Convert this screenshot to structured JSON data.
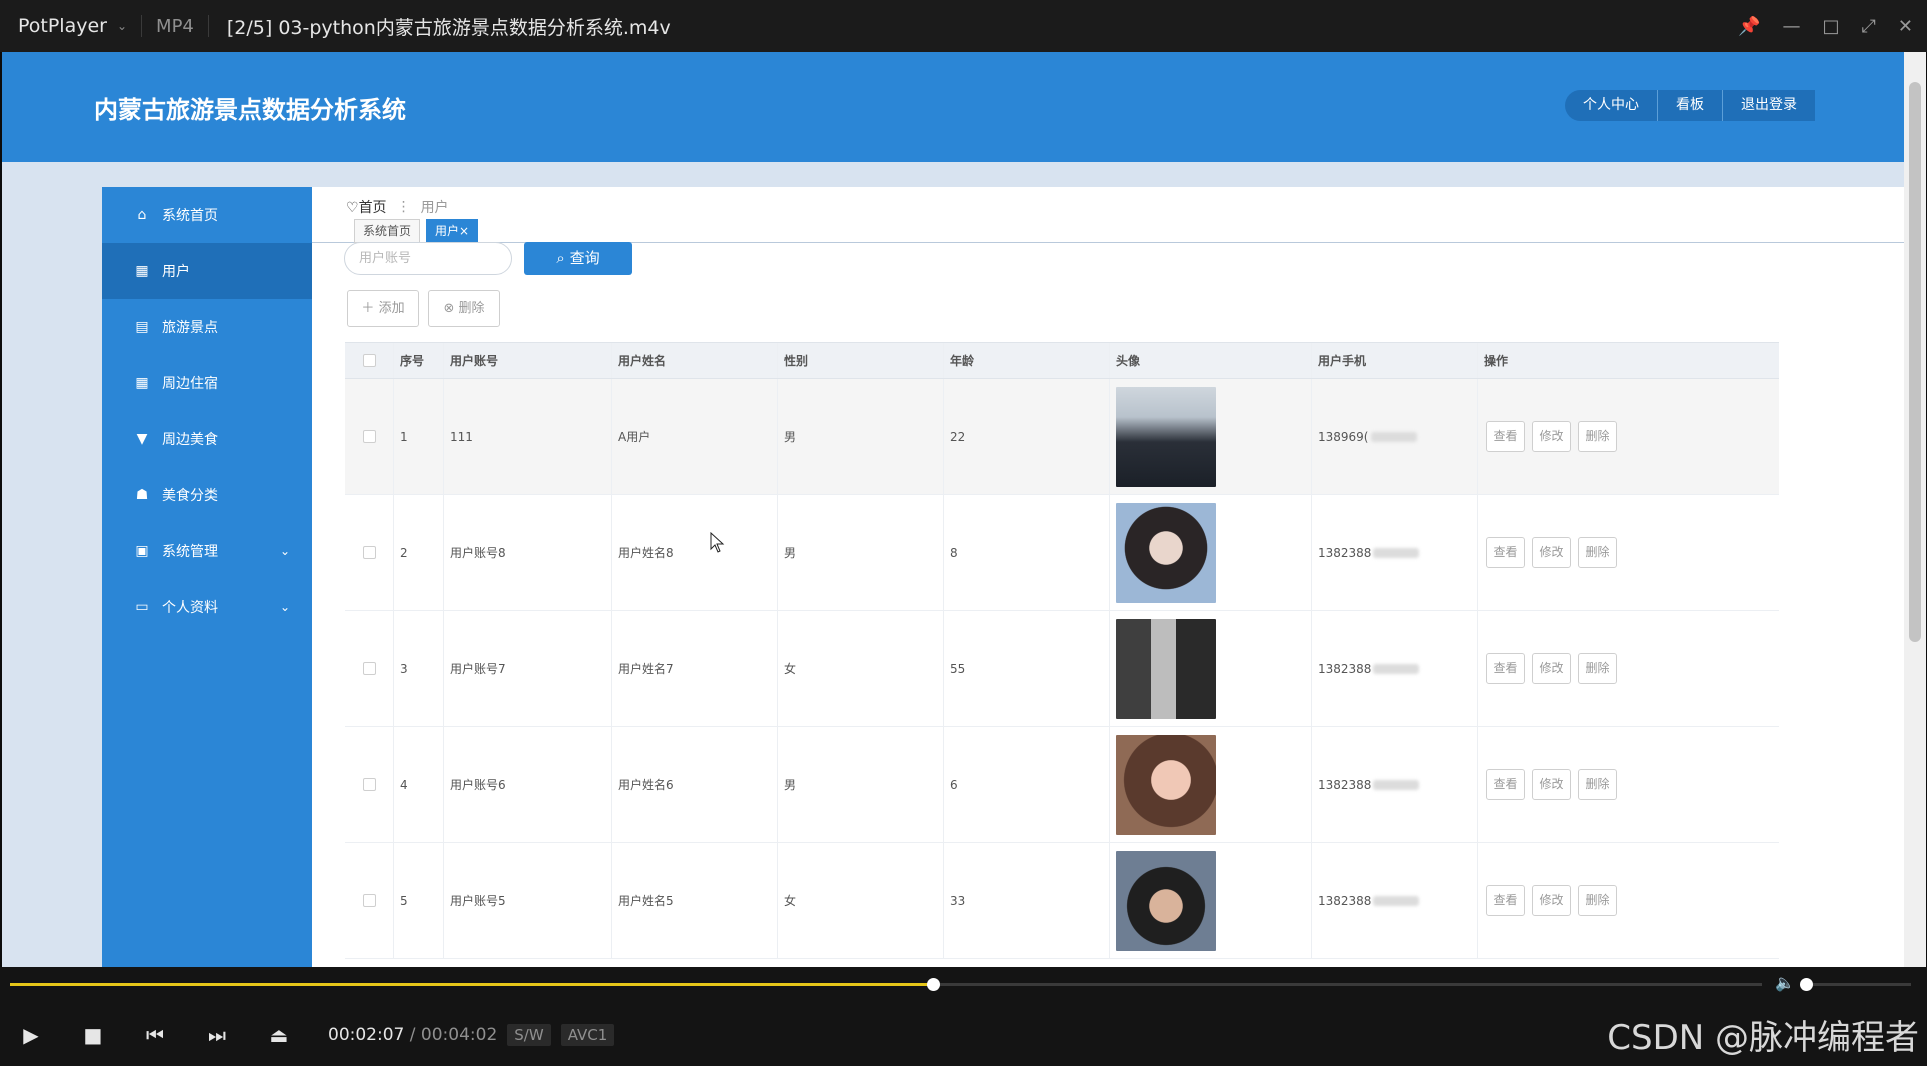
{
  "player": {
    "brand": "PotPlayer",
    "format": "MP4",
    "file_title": "[2/5] 03-python内蒙古旅游景点数据分析系统.m4v",
    "time_current": "00:02:07",
    "time_separator": "/",
    "time_total": "00:04:02",
    "badge_sw": "S/W",
    "badge_codec": "AVC1",
    "seek_progress": 0.527,
    "volume_level": 0.05,
    "watermark": "CSDN @脉冲编程者",
    "accent_color": "#e6c619"
  },
  "app": {
    "title": "内蒙古旅游景点数据分析系统",
    "primary_color": "#2b86d6",
    "top_nav": [
      "个人中心",
      "看板",
      "退出登录"
    ]
  },
  "sidebar": {
    "items": [
      {
        "label": "系统首页",
        "icon": "home-icon"
      },
      {
        "label": "用户",
        "icon": "grid-icon"
      },
      {
        "label": "旅游景点",
        "icon": "chat-icon"
      },
      {
        "label": "周边住宿",
        "icon": "grid-icon"
      },
      {
        "label": "周边美食",
        "icon": "cup-icon"
      },
      {
        "label": "美食分类",
        "icon": "hand-icon"
      },
      {
        "label": "系统管理",
        "icon": "clipboard-icon"
      },
      {
        "label": "个人资料",
        "icon": "card-icon"
      }
    ]
  },
  "breadcrumb": {
    "home": "首页",
    "separator": "⋮",
    "current": "用户"
  },
  "tabs": {
    "home": "系统首页",
    "user": "用户",
    "close": "×"
  },
  "search": {
    "placeholder": "用户账号",
    "button": "查询"
  },
  "actions": {
    "add": "添加",
    "delete": "删除"
  },
  "table": {
    "headers": [
      "序号",
      "用户账号",
      "用户姓名",
      "性别",
      "年龄",
      "头像",
      "用户手机",
      "操作"
    ],
    "op_view": "查看",
    "op_edit": "修改",
    "op_delete": "删除",
    "rows": [
      {
        "idx": "1",
        "account": "111",
        "name": "A用户",
        "gender": "男",
        "age": "22",
        "phone": "138969("
      },
      {
        "idx": "2",
        "account": "用户账号8",
        "name": "用户姓名8",
        "gender": "男",
        "age": "8",
        "phone": "1382388"
      },
      {
        "idx": "3",
        "account": "用户账号7",
        "name": "用户姓名7",
        "gender": "女",
        "age": "55",
        "phone": "1382388"
      },
      {
        "idx": "4",
        "account": "用户账号6",
        "name": "用户姓名6",
        "gender": "男",
        "age": "6",
        "phone": "1382388"
      },
      {
        "idx": "5",
        "account": "用户账号5",
        "name": "用户姓名5",
        "gender": "女",
        "age": "33",
        "phone": "1382388"
      }
    ]
  }
}
